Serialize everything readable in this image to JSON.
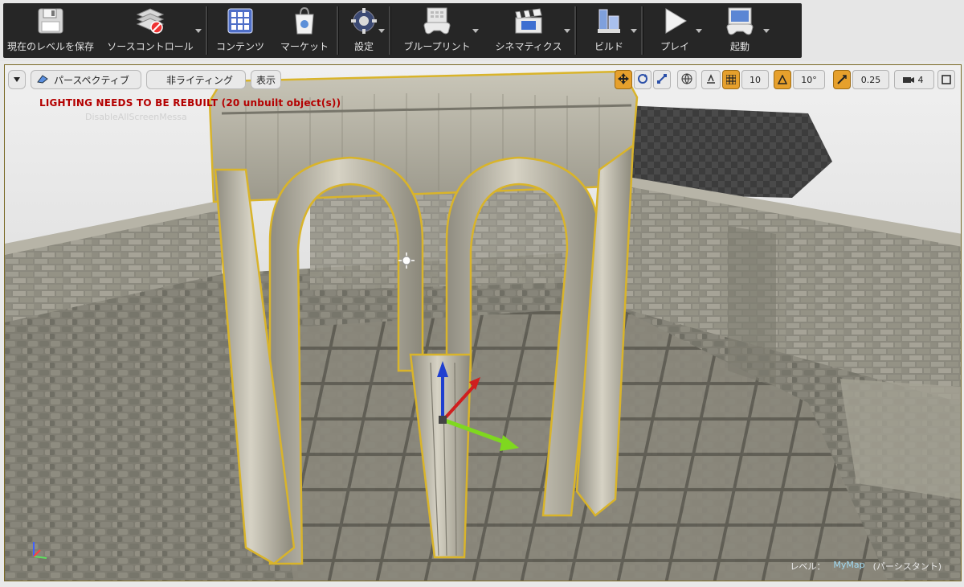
{
  "toolbar": {
    "buttons": [
      {
        "id": "save",
        "label": "現在のレベルを保存",
        "icon": "save-icon",
        "dropdown": false
      },
      {
        "id": "source",
        "label": "ソースコントロール",
        "icon": "source-control-icon",
        "dropdown": true
      },
      {
        "id": "content",
        "label": "コンテンツ",
        "icon": "content-grid-icon",
        "dropdown": false
      },
      {
        "id": "market",
        "label": "マーケット",
        "icon": "marketplace-icon",
        "dropdown": false
      },
      {
        "id": "settings",
        "label": "設定",
        "icon": "settings-icon",
        "dropdown": true
      },
      {
        "id": "blueprint",
        "label": "ブループリント",
        "icon": "blueprint-icon",
        "dropdown": true
      },
      {
        "id": "cinematics",
        "label": "シネマティクス",
        "icon": "clapper-icon",
        "dropdown": true
      },
      {
        "id": "build",
        "label": "ビルド",
        "icon": "build-icon",
        "dropdown": true
      },
      {
        "id": "play",
        "label": "プレイ",
        "icon": "play-icon",
        "dropdown": true
      },
      {
        "id": "launch",
        "label": "起動",
        "icon": "launch-icon",
        "dropdown": true
      }
    ]
  },
  "viewport_toolbar": {
    "perspective_label": "パースペクティブ",
    "lighting_label": "非ライティング",
    "show_label": "表示",
    "grid_snap": "10",
    "rotation_snap": "10°",
    "scale_snap": "0.25",
    "camera_speed": "4"
  },
  "viewport": {
    "warning": "LIGHTING NEEDS TO BE REBUILT (20 unbuilt object(s))",
    "faint_message": "DisableAllScreenMessa",
    "level_label": "レベル：",
    "level_name": "MyMap",
    "level_suffix": "(パーシスタント)"
  },
  "colors": {
    "toolbar_bg": "#262626",
    "active_tool": "#e6a02c",
    "warning": "#b40000",
    "selection_outline": "#d9b42a"
  }
}
